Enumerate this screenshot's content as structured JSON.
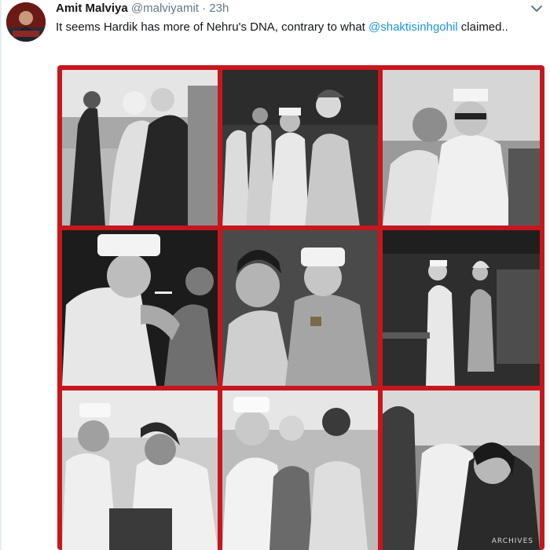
{
  "tweet": {
    "author_name": "Amit Malviya",
    "handle": "@malviyamit",
    "separator": "·",
    "timestamp": "23h",
    "text_before": "It seems Hardik has more of Nehru's DNA, contrary to what ",
    "mention": "@shaktisinhgohil",
    "text_after": " claimed..",
    "more_icon": "chevron-down-icon",
    "avatar_description_icon": "avatar"
  },
  "colors": {
    "mention": "#1b95e0",
    "collage_border": "#c8161e",
    "secondary_text": "#657786"
  },
  "collage": {
    "photo_count": 9,
    "watermark": "ARCHIVES"
  }
}
